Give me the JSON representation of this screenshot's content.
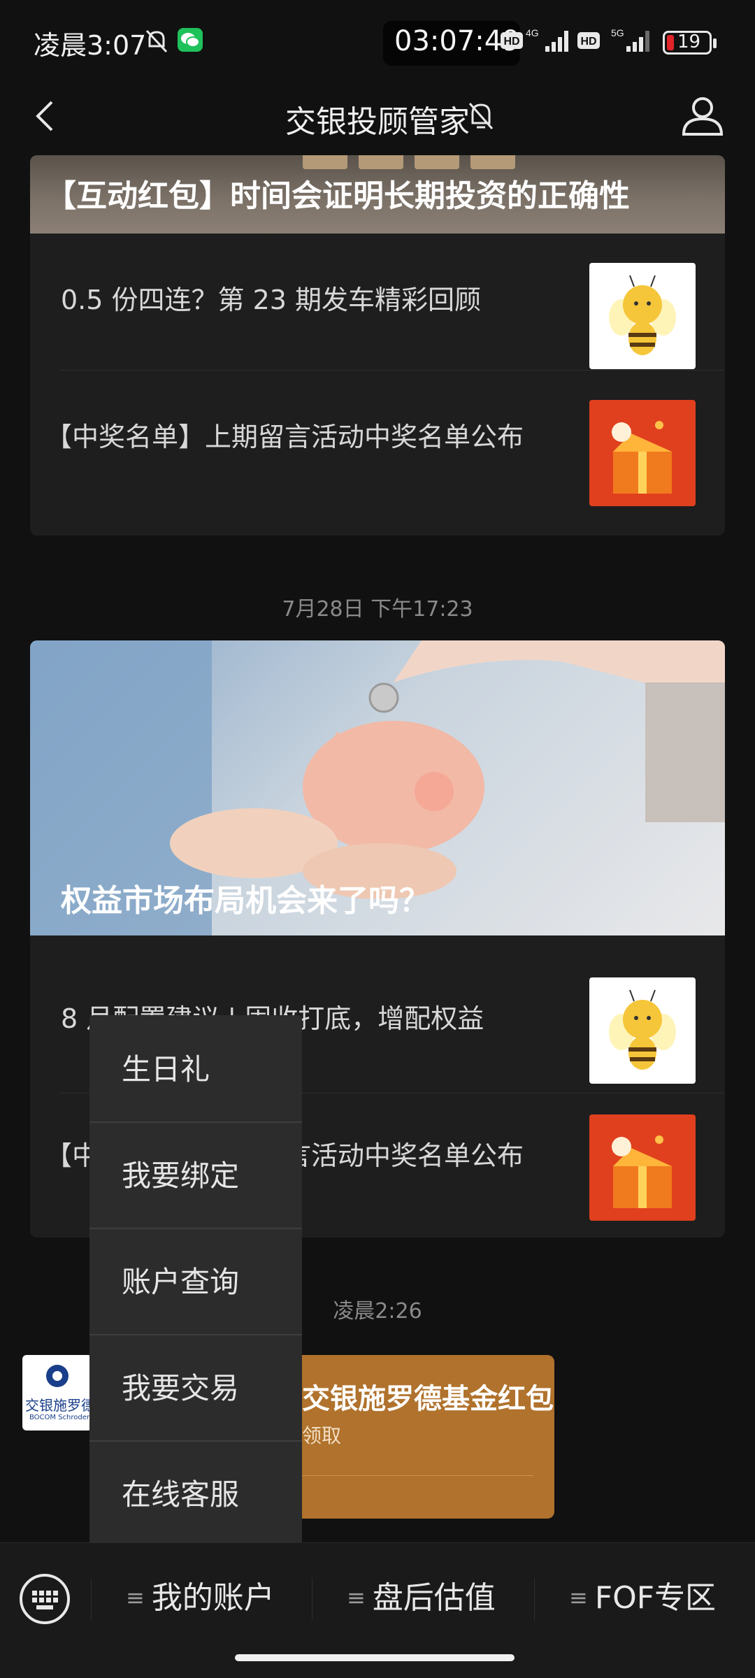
{
  "status_bar": {
    "time": "凌晨3:07",
    "clock": "03:07:49",
    "network_1": "4G",
    "network_2": "5G",
    "hd_1": "HD",
    "hd_2": "HD",
    "battery": "19"
  },
  "nav": {
    "title": "交银投顾管家"
  },
  "feed": {
    "card1": {
      "banner_title": "【互动红包】时间会证明长期投资的正确性",
      "rows": [
        {
          "text": "0.5 份四连？第 23 期发车精彩回顾",
          "thumb": "bee"
        },
        {
          "text": "【中奖名单】上期留言活动中奖名单公布",
          "thumb": "gift-box"
        }
      ]
    },
    "timestamp_1": "7月28日 下午17:23",
    "card2": {
      "banner_title": "权益市场布局机会来了吗？",
      "rows": [
        {
          "text": "8 月配置建议 | 固收打底，增配权益",
          "thumb": "bee"
        },
        {
          "text": "【中奖名单】上期留言活动中奖名单公布",
          "thumb": "gift-box"
        }
      ]
    },
    "timestamp_2": "凌晨2:26",
    "red_packet": {
      "avatar_name": "交银施罗德",
      "avatar_sub": "BOCOM Schroders",
      "title": "交银施罗德基金红包",
      "subtitle": "领取"
    }
  },
  "popup_menu": {
    "items": [
      "生日礼",
      "我要绑定",
      "账户查询",
      "我要交易",
      "在线客服"
    ]
  },
  "bottom_menu": {
    "tabs": [
      "我的账户",
      "盘后估值",
      "FOF专区"
    ]
  },
  "colors": {
    "background": "#111111",
    "card": "#1e1e1e",
    "popup": "#2c2c2c",
    "red_packet": "#b0722c",
    "wechat_green": "#1fc15a"
  }
}
